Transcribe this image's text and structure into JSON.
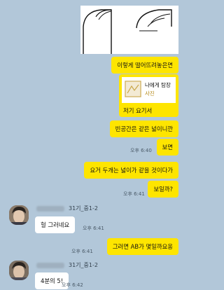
{
  "messages": {
    "m1": "이렇게 떨어뜨려놓은면",
    "share_title": "나에게 탐장",
    "share_sub": "사진",
    "m2": "저기 요기서",
    "m3": "빈공간은 같은 넓이니깐",
    "t1": "오후 6:40",
    "m4": "보면",
    "m5": "요거 두개는 넓이가 같을 것이다가",
    "t2": "오후 6:41",
    "m6": "보일까?",
    "sender1": "31기_중1-2",
    "m7": "헐 그러네요",
    "t3": "오후 6:41",
    "t4": "오후 6:41",
    "m8": "그러면 AB가 몇일까요옹",
    "sender2": "31기_중1-2",
    "m9": "4분의 5!",
    "t5": "오후 6:42"
  },
  "colors": {
    "background": "#b2c7d9",
    "my_bubble": "#fee500",
    "other_bubble": "#ffffff"
  }
}
